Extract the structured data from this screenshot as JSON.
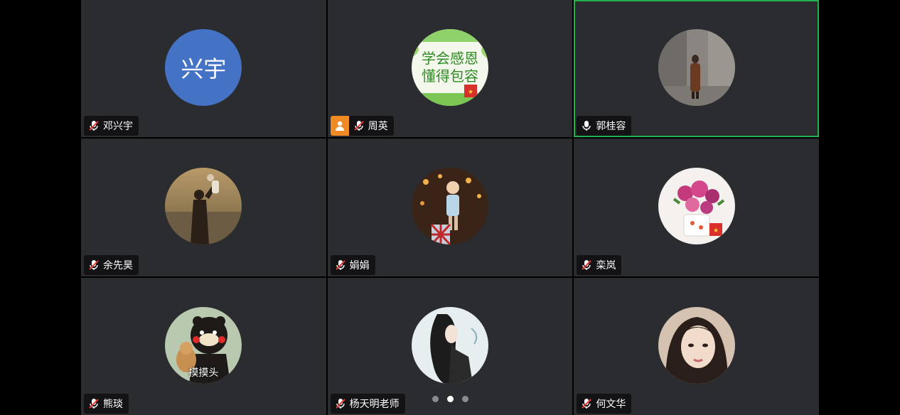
{
  "colors": {
    "tile_bg": "#2b2c30",
    "active_border": "#22b14c",
    "host_badge": "#f08a24",
    "avatar_blue": "#4472c4"
  },
  "participants": [
    {
      "name": "邓兴宇",
      "mic": "muted",
      "avatar_text": "兴宇"
    },
    {
      "name": "周英",
      "mic": "muted",
      "host": true,
      "avatar_lines": [
        "学会感恩",
        "懂得包容"
      ]
    },
    {
      "name": "郭桂容",
      "mic": "on",
      "active_speaker": true
    },
    {
      "name": "余先昊",
      "mic": "muted"
    },
    {
      "name": "娟娟",
      "mic": "muted"
    },
    {
      "name": "栾岚",
      "mic": "muted"
    },
    {
      "name": "熊琰",
      "mic": "muted",
      "avatar_caption": "摸摸头"
    },
    {
      "name": "杨天明老师",
      "mic": "muted"
    },
    {
      "name": "何文华",
      "mic": "muted"
    }
  ],
  "pagination": {
    "pages": 3,
    "current": 2
  }
}
